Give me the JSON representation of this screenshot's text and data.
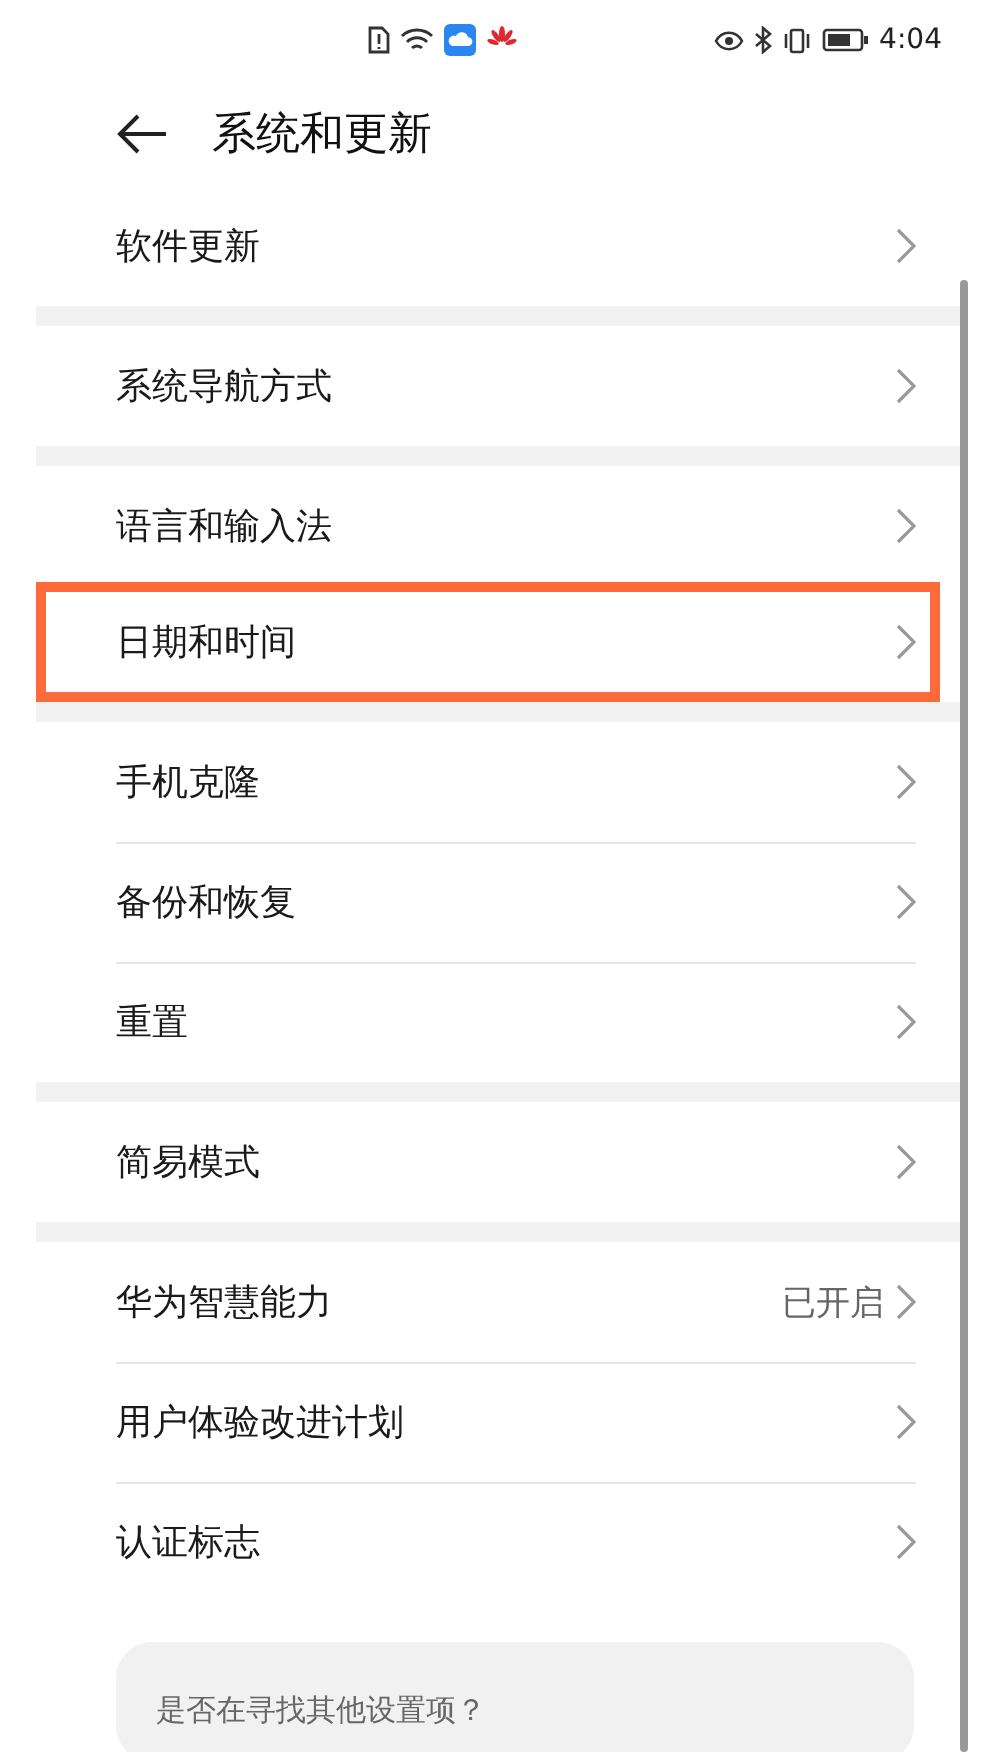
{
  "status_bar": {
    "time": "4:04"
  },
  "header": {
    "title": "系统和更新"
  },
  "groups": [
    {
      "items": [
        {
          "label": "软件更新",
          "highlighted": false
        }
      ]
    },
    {
      "items": [
        {
          "label": "系统导航方式",
          "highlighted": false
        }
      ]
    },
    {
      "items": [
        {
          "label": "语言和输入法",
          "highlighted": false
        },
        {
          "label": "日期和时间",
          "highlighted": true
        }
      ]
    },
    {
      "items": [
        {
          "label": "手机克隆",
          "highlighted": false
        },
        {
          "label": "备份和恢复",
          "highlighted": false
        },
        {
          "label": "重置",
          "highlighted": false
        }
      ]
    },
    {
      "items": [
        {
          "label": "简易模式",
          "highlighted": false
        }
      ]
    },
    {
      "items": [
        {
          "label": "华为智慧能力",
          "value": "已开启",
          "highlighted": false
        },
        {
          "label": "用户体验改进计划",
          "highlighted": false
        },
        {
          "label": "认证标志",
          "highlighted": false
        }
      ]
    }
  ],
  "suggestion_card": {
    "text": "是否在寻找其他设置项？"
  }
}
